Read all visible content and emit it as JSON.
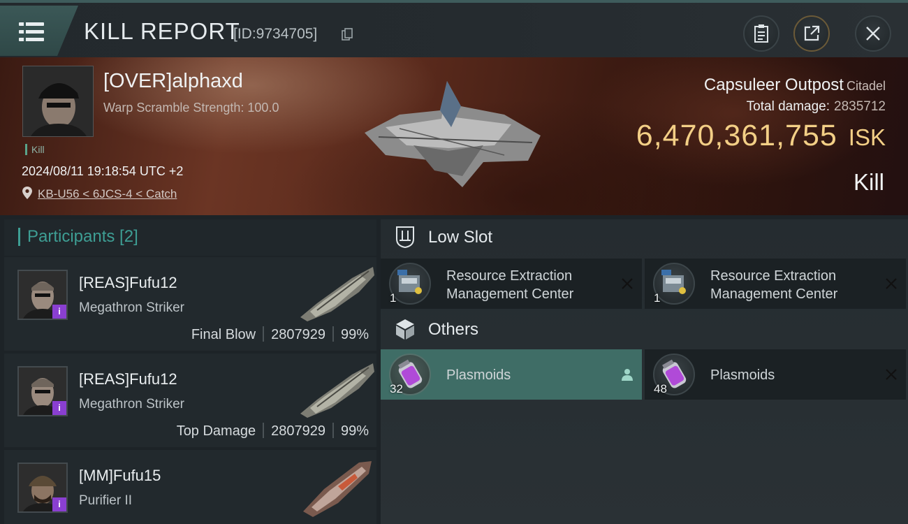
{
  "header": {
    "title": "KILL REPORT",
    "report_id": "[ID:9734705]",
    "icons": {
      "menu": "menu-icon",
      "copy": "copy-icon",
      "clipboard": "clipboard-icon",
      "share": "share-icon",
      "close": "close-icon"
    }
  },
  "victim": {
    "name": "[OVER]alphaxd",
    "subtitle": "Warp Scramble Strength: 100.0",
    "tag": "Kill",
    "timestamp": "2024/08/11 19:18:54 UTC +2",
    "location": "KB-U56 < 6JCS-4 < Catch"
  },
  "loss": {
    "ship_name": "Capsuleer Outpost",
    "ship_class": "Citadel",
    "damage_label": "Total damage:",
    "damage_value": "2835712",
    "isk_value": "6,470,361,755",
    "isk_unit": "ISK",
    "result": "Kill"
  },
  "participants": {
    "title": "Participants [2]",
    "items": [
      {
        "name": "[REAS]Fufu12",
        "ship": "Megathron Striker",
        "role": "Final Blow",
        "damage": "2807929",
        "percent": "99%",
        "badge": "i"
      },
      {
        "name": "[REAS]Fufu12",
        "ship": "Megathron Striker",
        "role": "Top Damage",
        "damage": "2807929",
        "percent": "99%",
        "badge": "i"
      },
      {
        "name": "[MM]Fufu15",
        "ship": "Purifier II",
        "badge": "i"
      }
    ]
  },
  "fitting": {
    "low_slot": {
      "title": "Low Slot",
      "items": [
        {
          "name": "Resource Extraction Management Center",
          "qty": "1",
          "status": "destroyed"
        },
        {
          "name": "Resource Extraction Management Center",
          "qty": "1",
          "status": "destroyed"
        }
      ]
    },
    "others": {
      "title": "Others",
      "items": [
        {
          "name": "Plasmoids",
          "qty": "32",
          "status": "dropped"
        },
        {
          "name": "Plasmoids",
          "qty": "48",
          "status": "destroyed"
        }
      ]
    }
  },
  "colors": {
    "accent_teal": "#3e9e94",
    "isk_gold": "#f3cf86",
    "highlight_row": "#3f6d66",
    "corp_badge": "#8a3fd1"
  }
}
